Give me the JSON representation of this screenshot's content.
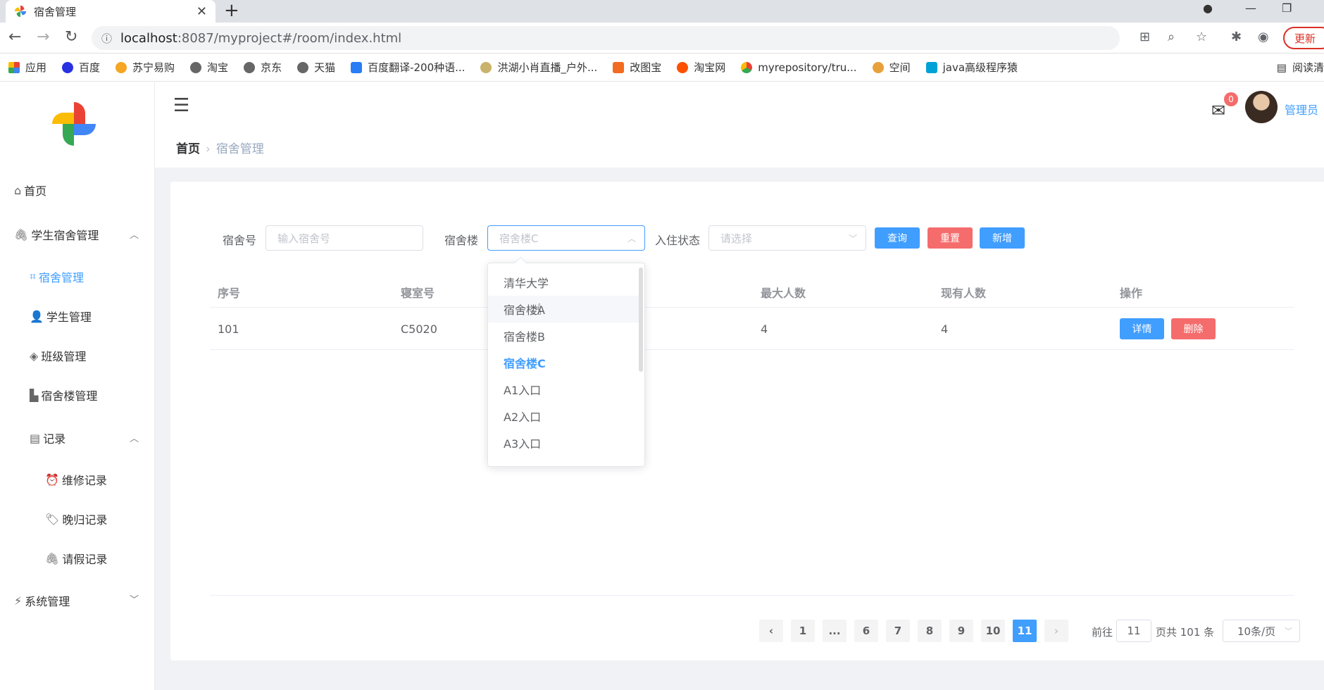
{
  "browser": {
    "tab_title": "宿舍管理",
    "url_host": "localhost",
    "url_path": ":8087/myproject#/room/index.html",
    "update_label": "更新",
    "bookmarks": [
      "应用",
      "百度",
      "苏宁易购",
      "淘宝",
      "京东",
      "天猫",
      "百度翻译-200种语...",
      "洪湖小肖直播_户外...",
      "改图宝",
      "淘宝网",
      "myrepository/tru...",
      "空间",
      "java高级程序猿",
      "阅读清"
    ]
  },
  "sidebar": {
    "items": [
      {
        "label": "首页",
        "icon": "home-icon"
      },
      {
        "label": "学生宿舍管理",
        "icon": "paperclip-icon"
      },
      {
        "label": "宿舍管理",
        "icon": "crop-icon"
      },
      {
        "label": "学生管理",
        "icon": "user-icon"
      },
      {
        "label": "班级管理",
        "icon": "school-icon"
      },
      {
        "label": "宿舍楼管理",
        "icon": "building-icon"
      },
      {
        "label": "记录",
        "icon": "notebook-icon"
      },
      {
        "label": "维修记录",
        "icon": "alarm-icon"
      },
      {
        "label": "晚归记录",
        "icon": "tag-icon"
      },
      {
        "label": "请假记录",
        "icon": "paperclip-icon"
      },
      {
        "label": "系统管理",
        "icon": "lightning-icon"
      }
    ]
  },
  "header": {
    "breadcrumb_home": "首页",
    "breadcrumb_current": "宿舍管理",
    "mail_count": "0",
    "username": "管理员"
  },
  "filters": {
    "room_label": "宿舍号",
    "room_placeholder": "输入宿舍号",
    "building_label": "宿舍楼",
    "building_value": "宿舍楼C",
    "status_label": "入住状态",
    "status_placeholder": "请选择",
    "query_label": "查询",
    "reset_label": "重置",
    "add_label": "新增"
  },
  "table": {
    "headers": [
      "序号",
      "寝室号",
      "最大人数",
      "现有人数",
      "操作"
    ],
    "rows": [
      {
        "index": "101",
        "room": "C5020",
        "max": "4",
        "current": "4",
        "detail": "详情",
        "delete": "删除"
      }
    ]
  },
  "dropdown": {
    "options": [
      "清华大学",
      "宿舍楼A",
      "宿舍楼B",
      "宿舍楼C",
      "A1入口",
      "A2入口",
      "A3入口"
    ],
    "hovered": "宿舍楼A",
    "selected": "宿舍楼C"
  },
  "pagination": {
    "pages": [
      "1",
      "...",
      "6",
      "7",
      "8",
      "9",
      "10",
      "11"
    ],
    "current": "11",
    "goto_label": "前往",
    "goto_value": "11",
    "total_text": "页共 101 条",
    "page_size": "10条/页"
  }
}
